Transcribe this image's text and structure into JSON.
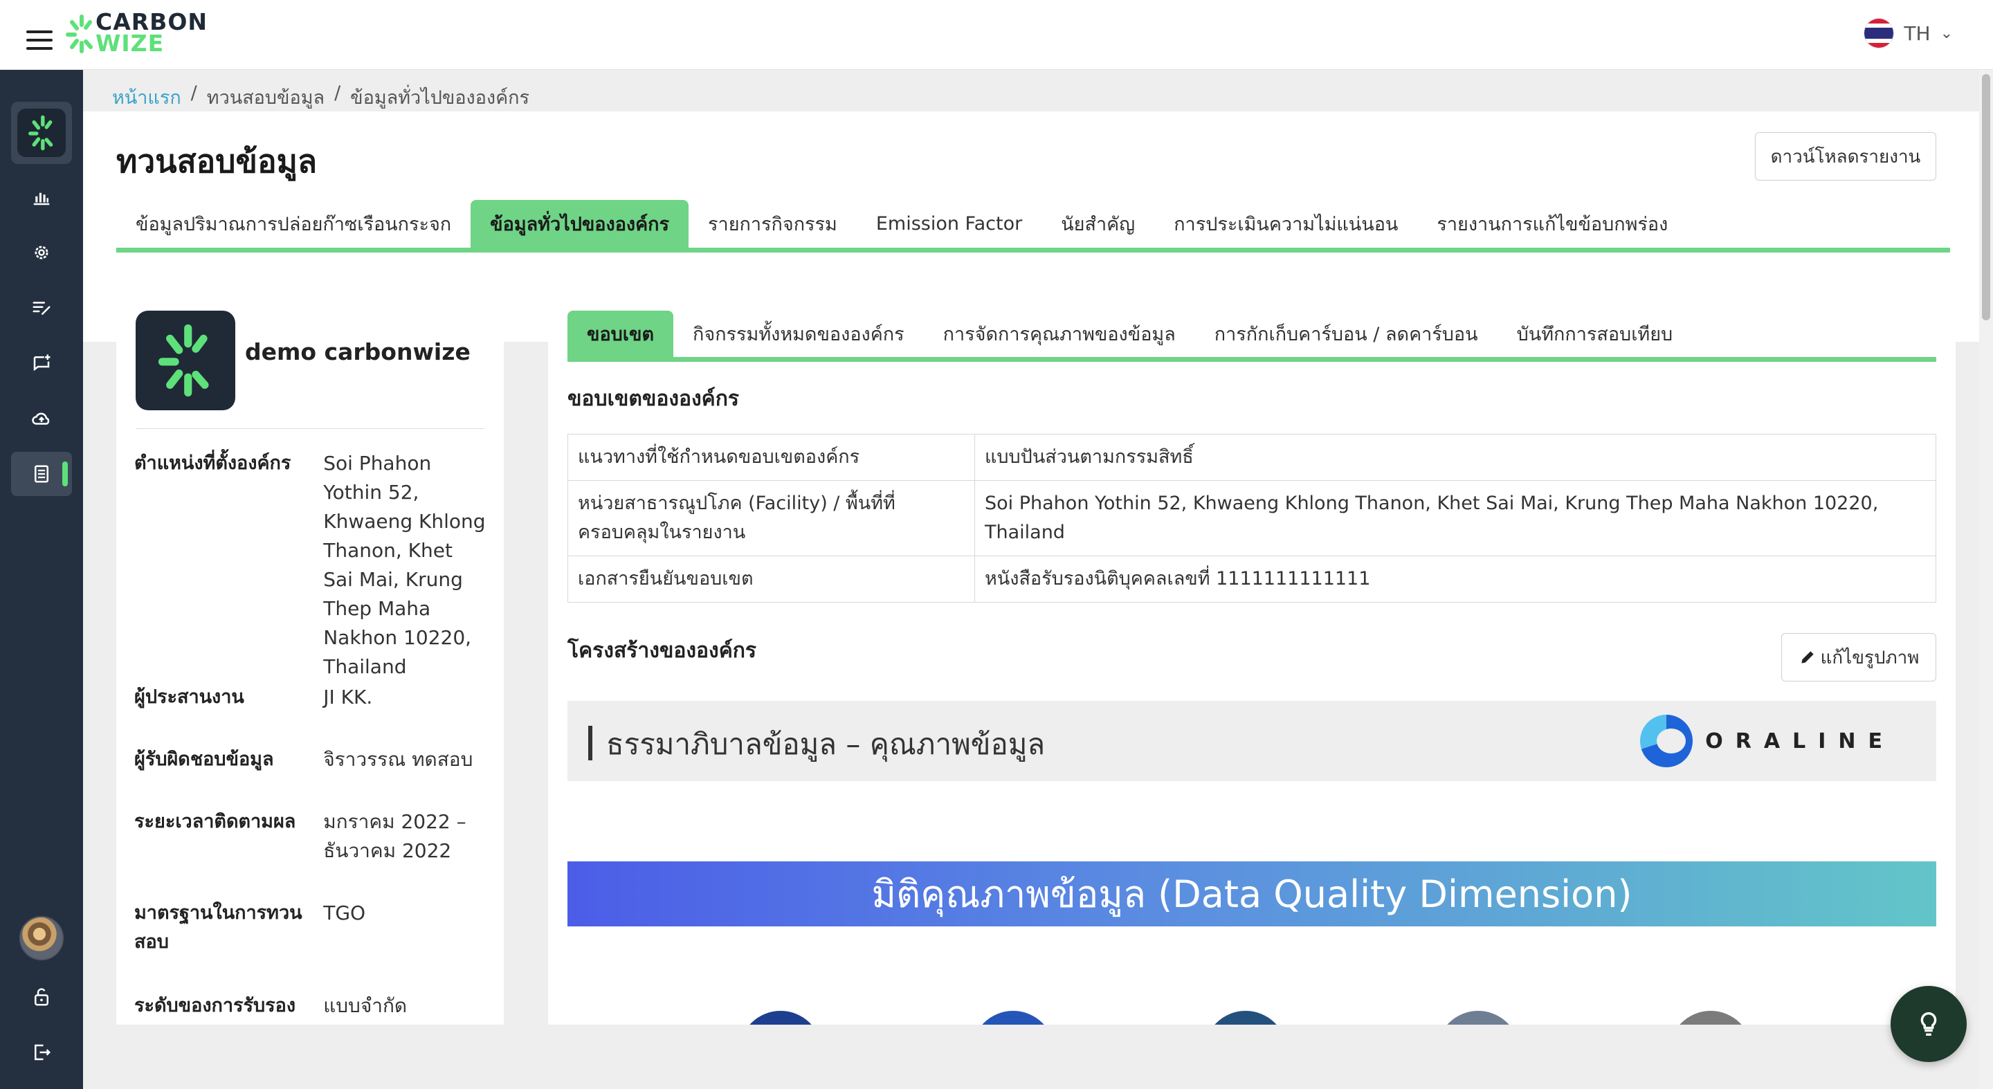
{
  "app": {
    "logo_line1": "CARBON",
    "logo_line2": "WIZE",
    "language": "TH",
    "accent_color": "#6fd486",
    "sidebar_color": "#243040"
  },
  "sidebar": {
    "items": [
      {
        "icon": "carbonwize-home-icon"
      },
      {
        "icon": "bar-chart-icon"
      },
      {
        "icon": "gear-icon"
      },
      {
        "icon": "edit-list-icon"
      },
      {
        "icon": "message-add-icon"
      },
      {
        "icon": "cloud-upload-icon"
      },
      {
        "icon": "document-icon",
        "active": true
      }
    ],
    "bottom": [
      {
        "icon": "avatar"
      },
      {
        "icon": "unlock-icon"
      },
      {
        "icon": "logout-icon"
      }
    ]
  },
  "breadcrumb": {
    "home": "หน้าแรก",
    "level2": "ทวนสอบข้อมูล",
    "level3": "ข้อมูลทั่วไปขององค์กร",
    "separator": "/"
  },
  "header": {
    "title": "ทวนสอบข้อมูล",
    "download_label": "ดาวน์โหลดรายงาน",
    "tabs": [
      {
        "label": "ข้อมูลปริมาณการปล่อยก๊าซเรือนกระจก"
      },
      {
        "label": "ข้อมูลทั่วไปขององค์กร",
        "active": true
      },
      {
        "label": "รายการกิจกรรม"
      },
      {
        "label": "Emission Factor"
      },
      {
        "label": "นัยสำคัญ"
      },
      {
        "label": "การประเมินความไม่แน่นอน"
      },
      {
        "label": "รายงานการแก้ไขข้อบกพร่อง"
      }
    ]
  },
  "org": {
    "name": "demo carbonwize",
    "fields": [
      {
        "label": "ตำแหน่งที่ตั้งองค์กร",
        "value": "Soi Phahon Yothin 52, Khwaeng Khlong Thanon, Khet Sai Mai, Krung Thep Maha Nakhon 10220, Thailand"
      },
      {
        "label": "ผู้ประสานงาน",
        "value": "JI KK."
      },
      {
        "label": "ผู้รับผิดชอบข้อมูล",
        "value": "จิราวรรณ ทดสอบ"
      },
      {
        "label": "ระยะเวลาติดตามผล",
        "value": "มกราคม 2022 – ธันวาคม 2022"
      },
      {
        "label": "มาตรฐานในการทวนสอบ",
        "value": "TGO"
      },
      {
        "label": "ระดับของการรับรอง",
        "value": "แบบจำกัด (Limited"
      }
    ]
  },
  "content": {
    "subtabs": [
      {
        "label": "ขอบเขต",
        "active": true
      },
      {
        "label": "กิจกรรมทั้งหมดขององค์กร"
      },
      {
        "label": "การจัดการคุณภาพของข้อมูล"
      },
      {
        "label": "การกักเก็บคาร์บอน / ลดคาร์บอน"
      },
      {
        "label": "บันทึกการสอบเทียบ"
      }
    ],
    "scope_title": "ขอบเขตขององค์กร",
    "scope_rows": [
      {
        "label": "แนวทางที่ใช้กำหนดขอบเขตองค์กร",
        "value": "แบบปันส่วนตามกรรมสิทธิ์"
      },
      {
        "label": "หน่วยสาธารณูปโภค (Facility) / พื้นที่ที่ครอบคลุมในรายงาน",
        "value": "Soi Phahon Yothin 52, Khwaeng Khlong Thanon, Khet Sai Mai, Krung Thep Maha Nakhon 10220, Thailand"
      },
      {
        "label": "เอกสารยืนยันขอบเขต",
        "value": "หนังสือรับรองนิติบุคคลเลขที่ 1111111111111"
      }
    ],
    "structure_title": "โครงสร้างขององค์กร",
    "edit_image_label": "แก้ไขรูปภาพ",
    "image_banner_text": "ธรรมาภิบาลข้อมูล – คุณภาพข้อมูล",
    "image_brand": "ORALINE",
    "image_heading": "มิติคุณภาพข้อมูล (Data Quality Dimension)"
  }
}
